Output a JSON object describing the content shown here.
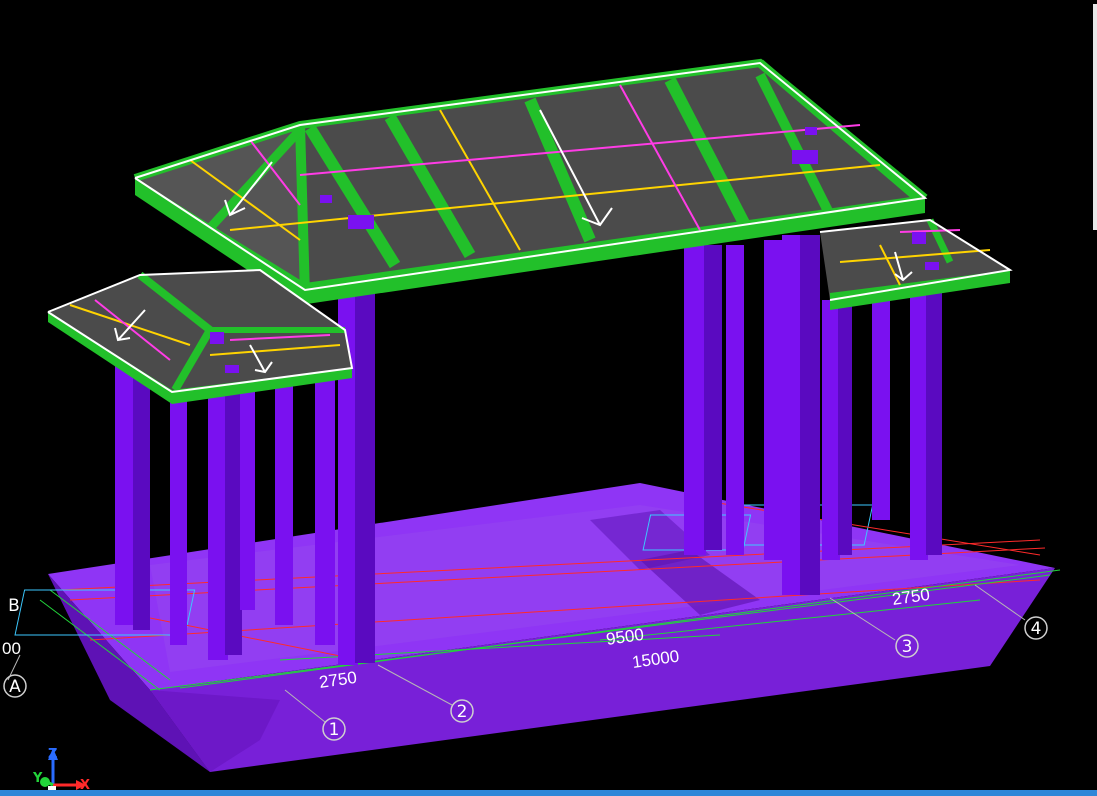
{
  "viewport": {
    "dimensions": {
      "left_span": "2750",
      "middle_span": "9500",
      "right_span": "2750",
      "total": "15000",
      "left_partial": "00"
    },
    "grid_labels": {
      "col_1": "1",
      "col_2": "2",
      "col_3": "3",
      "col_4": "4",
      "row_a": "A",
      "row_b": "B"
    },
    "axes": {
      "x": "X",
      "y": "Y",
      "z": "Z"
    }
  },
  "colors": {
    "background": "#000000",
    "roof_panel": "#4a4a4a",
    "roof_beam": "#22c02a",
    "column": "#7a11f0",
    "base": "#8a2ef0",
    "accent_bar": "#2f86d8"
  }
}
